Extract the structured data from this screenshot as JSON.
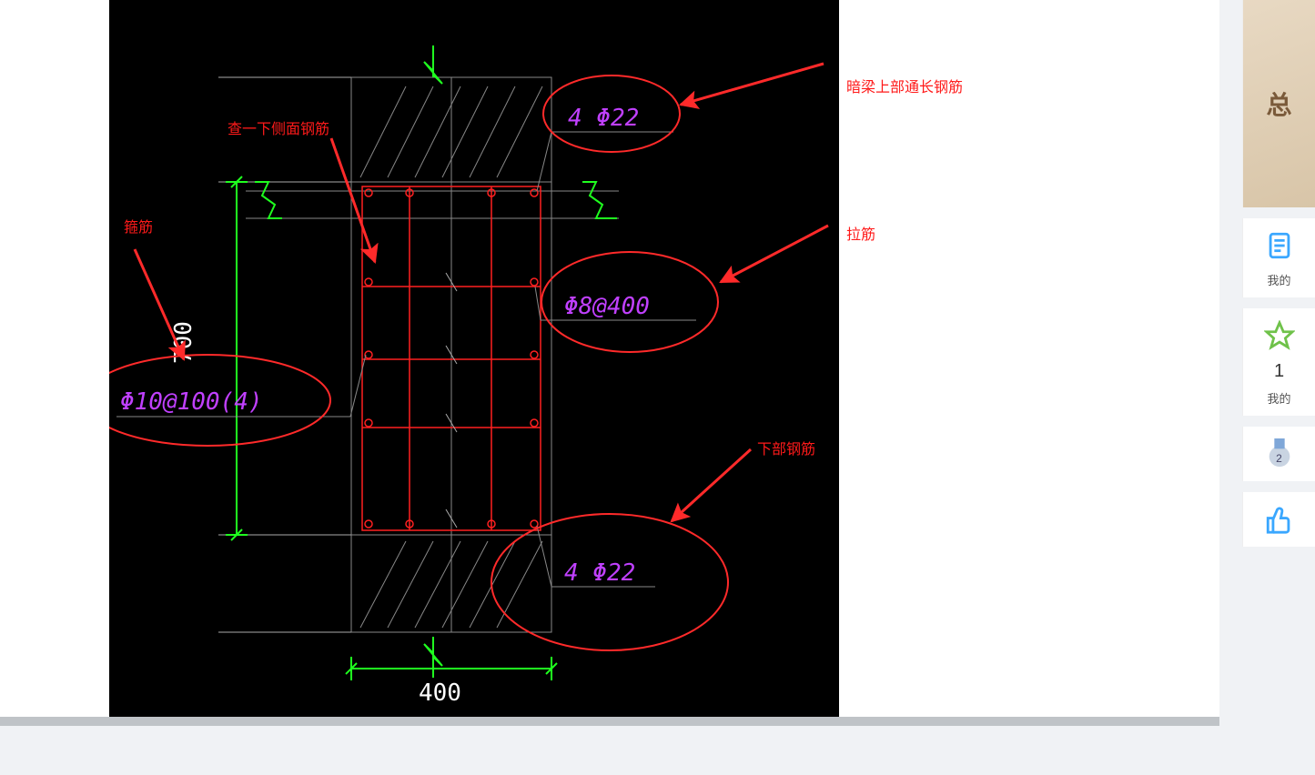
{
  "diagram": {
    "dimension_vertical": "700",
    "dimension_horizontal": "400",
    "top_rebar_label": "4 Φ22",
    "tie_bar_label": "Φ8@400",
    "stirrup_label": "Φ10@100(4)",
    "bottom_rebar_label": "4 Φ22"
  },
  "annotations": {
    "side_rebar_check": "查一下侧面钢筋",
    "stirrup": "箍筋",
    "top_continuous": "暗梁上部通长钢筋",
    "tie": "拉筋",
    "bottom": "下部钢筋"
  },
  "sidebar": {
    "promo_text": "总",
    "my_label": "我的",
    "rank_label": "我的",
    "rank_number": "1",
    "badge_number": "2"
  }
}
